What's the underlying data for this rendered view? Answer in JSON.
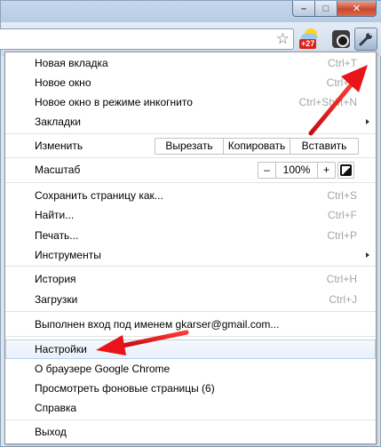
{
  "window": {
    "minimize_glyph": "–",
    "maximize_glyph": "□",
    "close_glyph": "✕"
  },
  "toolbar": {
    "weather_badge": "+27"
  },
  "menu": {
    "new_tab": {
      "label": "Новая вкладка",
      "shortcut": "Ctrl+T"
    },
    "new_window": {
      "label": "Новое окно",
      "shortcut": "Ctrl+N"
    },
    "incognito": {
      "label": "Новое окно в режиме инкогнито",
      "shortcut": "Ctrl+Shift+N"
    },
    "bookmarks": {
      "label": "Закладки"
    },
    "edit": {
      "label": "Изменить",
      "cut": "Вырезать",
      "copy": "Копировать",
      "paste": "Вставить"
    },
    "zoom": {
      "label": "Масштаб",
      "minus": "–",
      "value": "100%",
      "plus": "+"
    },
    "save_page": {
      "label": "Сохранить страницу как...",
      "shortcut": "Ctrl+S"
    },
    "find": {
      "label": "Найти...",
      "shortcut": "Ctrl+F"
    },
    "print": {
      "label": "Печать...",
      "shortcut": "Ctrl+P"
    },
    "tools": {
      "label": "Инструменты"
    },
    "history": {
      "label": "История",
      "shortcut": "Ctrl+H"
    },
    "downloads": {
      "label": "Загрузки",
      "shortcut": "Ctrl+J"
    },
    "signed_in": {
      "label": "Выполнен вход под именем gkarser@gmail.com..."
    },
    "settings": {
      "label": "Настройки"
    },
    "about": {
      "label": "О браузере Google Chrome"
    },
    "background_pages": {
      "label": "Просмотреть фоновые страницы (6)"
    },
    "help": {
      "label": "Справка"
    },
    "exit": {
      "label": "Выход"
    }
  },
  "colors": {
    "annotation_arrow": "#e8141a",
    "highlight_border": "#bcd2ee"
  }
}
